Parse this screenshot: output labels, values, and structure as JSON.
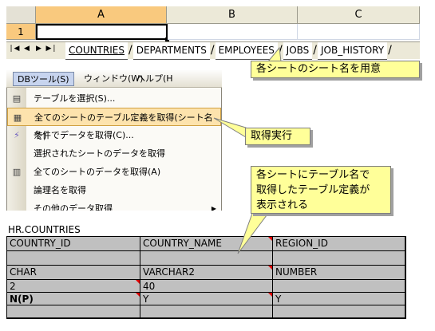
{
  "sheet": {
    "columns": [
      "A",
      "B",
      "C"
    ],
    "row_number": "1",
    "nav_icons": [
      "first-sheet-icon",
      "prev-sheet-icon",
      "next-sheet-icon",
      "last-sheet-icon"
    ],
    "tabs": [
      "COUNTRIES",
      "DEPARTMENTS",
      "EMPLOYEES",
      "JOBS",
      "JOB_HISTORY"
    ]
  },
  "callouts": {
    "sheet_names": "各シートのシート名を用意",
    "execute": "取得実行",
    "definition_line1": "各シートにテーブル名で",
    "definition_line2": "取得したテーブル定義が",
    "definition_line3": "表示される"
  },
  "menubar": {
    "items": [
      "DBツール(S)",
      "ウィンドウ(W)",
      "ヘルプ(H"
    ]
  },
  "menu": {
    "items": [
      {
        "label": "テーブルを選択(S)...",
        "icon": "table-select-icon"
      },
      {
        "label": "全てのシートのテーブル定義を取得(シート名で)",
        "icon": "grid-icon",
        "highlighted": true
      },
      {
        "label": "条件でデータを取得(C)...",
        "icon": "filter-icon"
      },
      {
        "label": "選択されたシートのデータを取得",
        "icon": ""
      },
      {
        "label": "全てのシートのデータを取得(A)",
        "icon": "sheets-icon"
      },
      {
        "label": "論理名を取得",
        "icon": ""
      },
      {
        "label": "その他のデータ取得",
        "icon": "",
        "submenu": true
      }
    ]
  },
  "table": {
    "title": "HR.COUNTRIES",
    "rows": [
      [
        "COUNTRY_ID",
        "COUNTRY_NAME",
        "REGION_ID"
      ],
      [
        "",
        "",
        ""
      ],
      [
        "CHAR",
        "VARCHAR2",
        "NUMBER"
      ],
      [
        "2",
        "40",
        ""
      ],
      [
        "N(P)",
        "Y",
        "Y"
      ],
      [
        "",
        "",
        ""
      ]
    ]
  },
  "colors": {
    "callout_fill": "#ffff99",
    "selected_header": "#f9c97e",
    "menu_highlight": "#fde3ad",
    "table_fill": "#c0c0c0",
    "comment_marker": "#e00000"
  }
}
